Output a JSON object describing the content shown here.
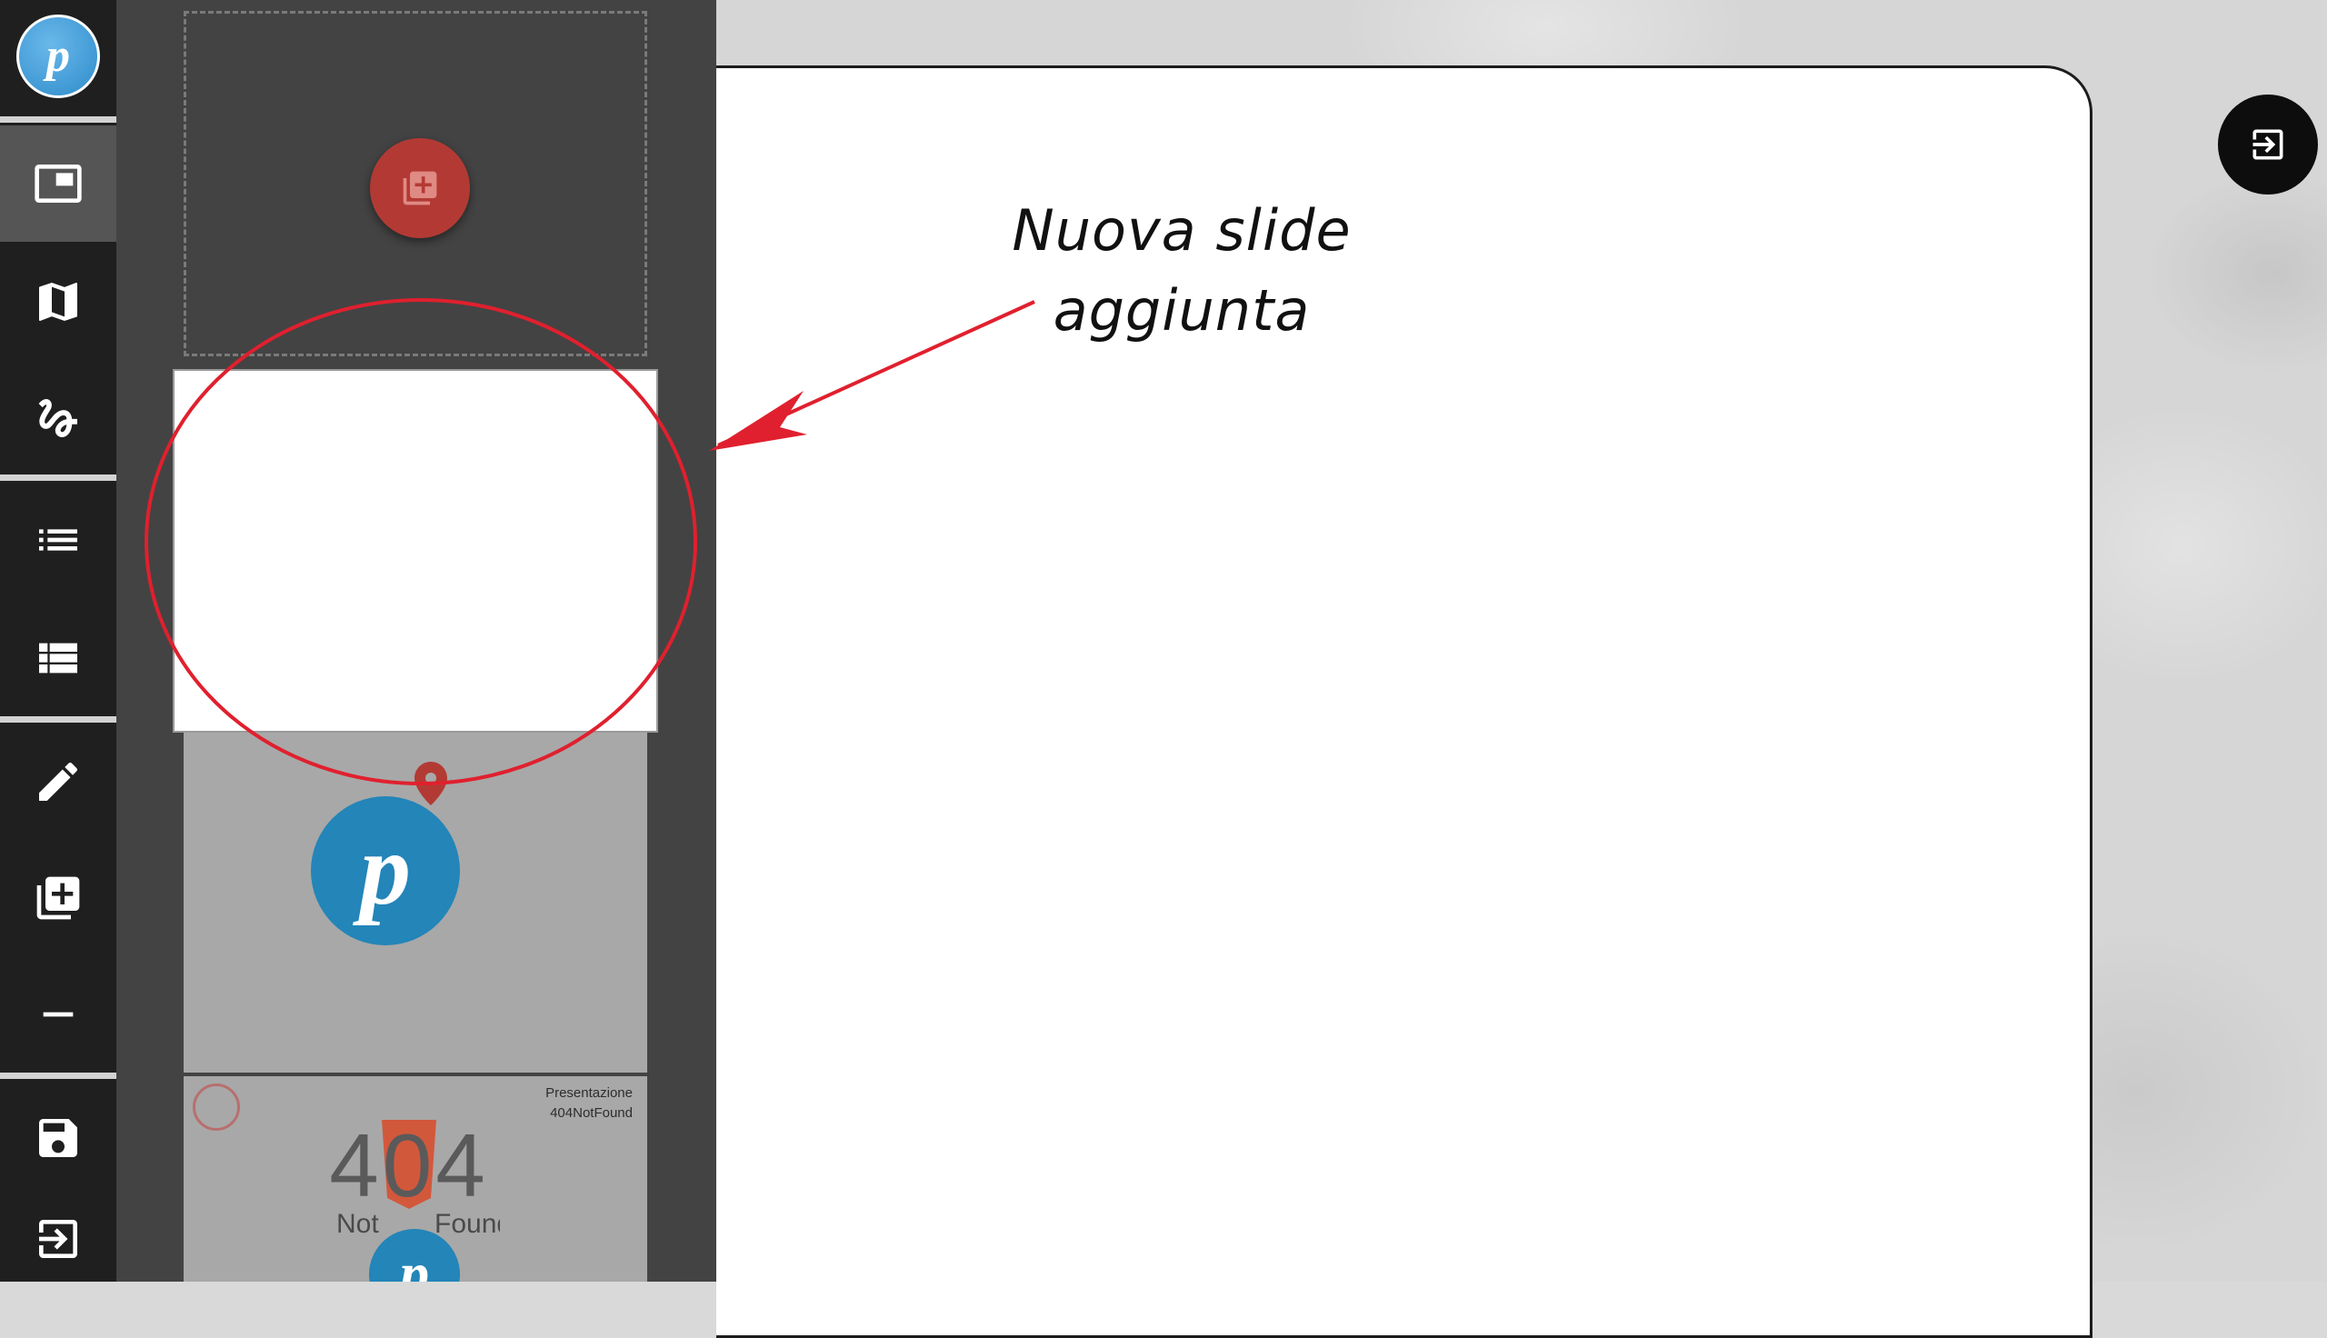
{
  "app": {
    "logo_letter": "p"
  },
  "toolbar": {
    "items": [
      {
        "icon": "slide-view-icon",
        "active": true
      },
      {
        "icon": "map-icon"
      },
      {
        "icon": "path-icon"
      },
      {
        "icon": "list-icon"
      },
      {
        "icon": "table-list-icon"
      },
      {
        "icon": "edit-pencil-icon"
      },
      {
        "icon": "add-slide-icon"
      },
      {
        "icon": "remove-icon"
      },
      {
        "icon": "save-icon"
      },
      {
        "icon": "exit-icon"
      }
    ]
  },
  "slide_panel": {
    "add_button_icon": "add-slide-icon",
    "thumb3": {
      "line1": "Presentazione",
      "line2": "404NotFound",
      "big_digits": "404",
      "small_left": "Not",
      "small_right": "Found"
    }
  },
  "annotation": {
    "line1": "Nuova slide",
    "line2": "aggiunta",
    "color": "#e0202e"
  },
  "exit_button_icon": "exit-icon"
}
